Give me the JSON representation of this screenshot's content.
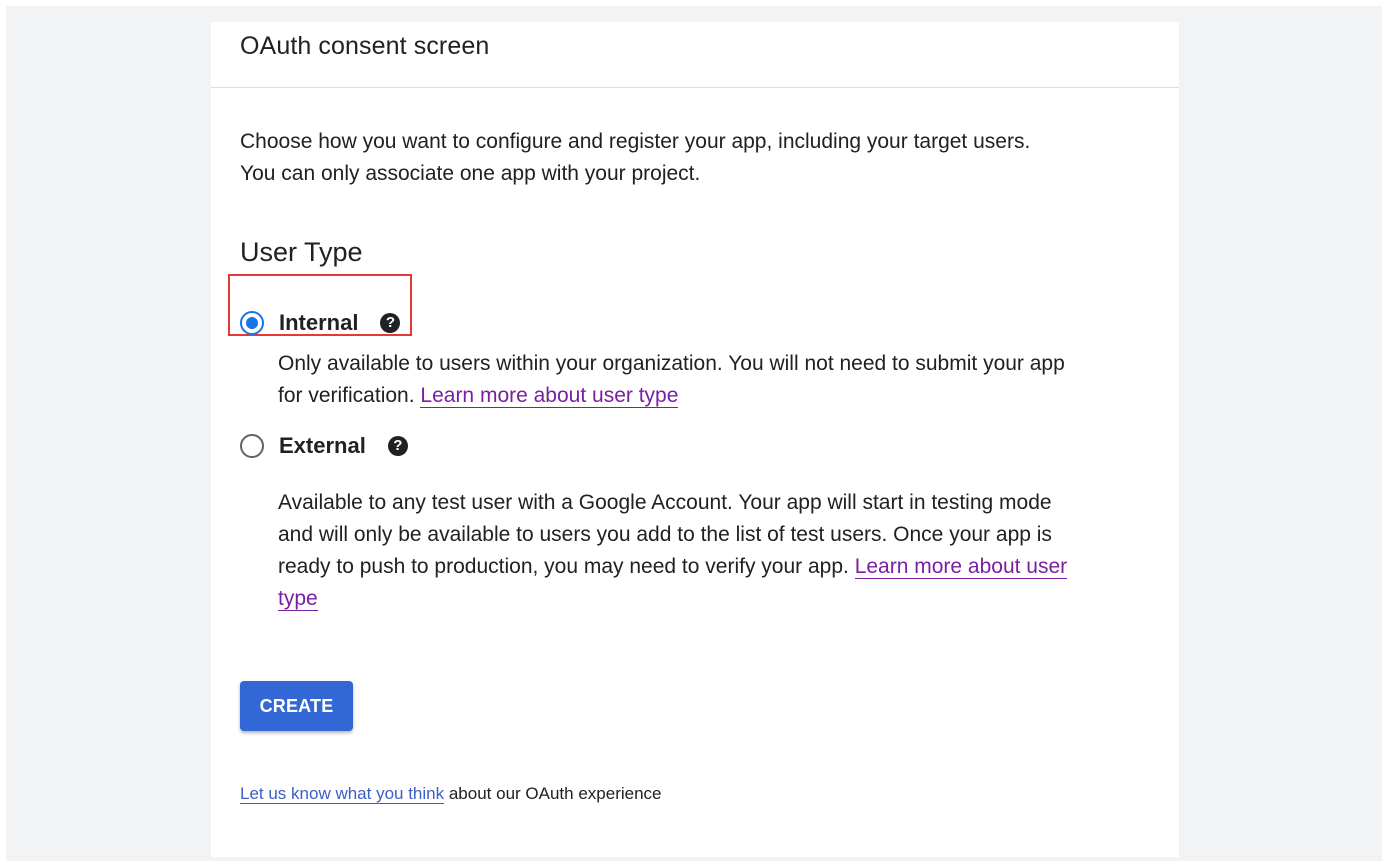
{
  "header": {
    "title": "OAuth consent screen"
  },
  "intro": {
    "text": "Choose how you want to configure and register your app, including your target users. You can only associate one app with your project."
  },
  "user_type": {
    "title": "User Type",
    "selected": "Internal",
    "options": [
      {
        "label": "Internal",
        "checked": true,
        "description": "Only available to users within your organization. You will not need to submit your app for verification.",
        "link": "Learn more about user type"
      },
      {
        "label": "External",
        "checked": false,
        "description": "Available to any test user with a Google Account. Your app will start in testing mode and will only be available to users you add to the list of test users. Once your app is ready to push to production, you may need to verify your app.",
        "link": "Learn more about user type"
      }
    ],
    "help_icon": "question-circle-icon",
    "help_glyph": "?"
  },
  "actions": {
    "create_label": "CREATE"
  },
  "feedback": {
    "link_text": "Let us know what you think",
    "trailing_text": " about our OAuth experience"
  },
  "colors": {
    "accent": "#1a73e8",
    "button": "#3367d6",
    "visited_link": "#7b1fa2",
    "highlight": "#e53935"
  }
}
